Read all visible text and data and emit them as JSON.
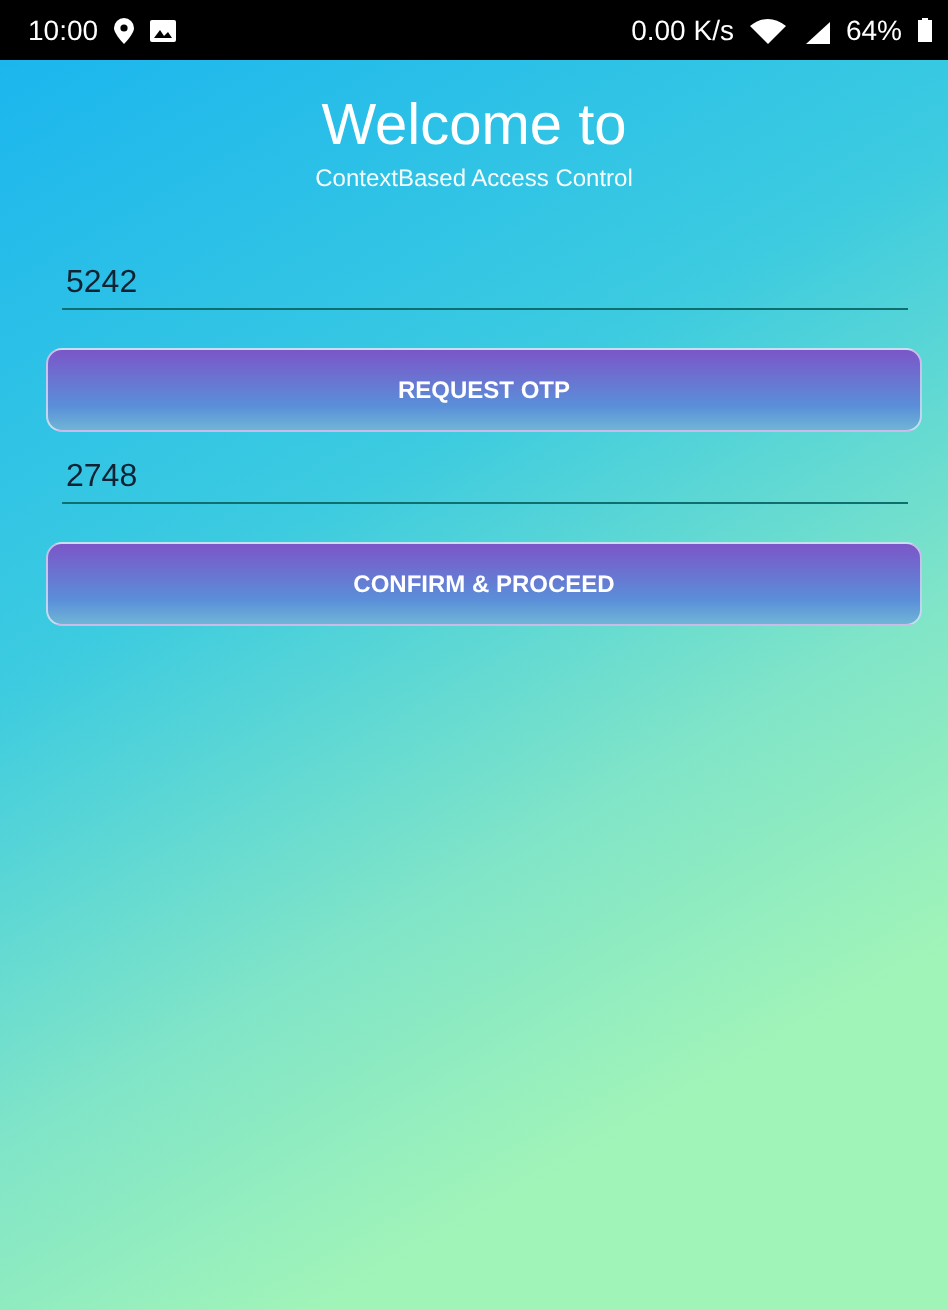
{
  "status_bar": {
    "time": "10:00",
    "net_speed": "0.00 K/s",
    "battery": "64%"
  },
  "title": "Welcome to",
  "subtitle": "ContextBased Access Control",
  "form": [
    {
      "kind": "field",
      "value": "5242"
    },
    {
      "kind": "button",
      "label": "REQUEST OTP"
    },
    {
      "kind": "field",
      "value": "2748"
    },
    {
      "kind": "button",
      "label": "CONFIRM & PROCEED"
    }
  ]
}
